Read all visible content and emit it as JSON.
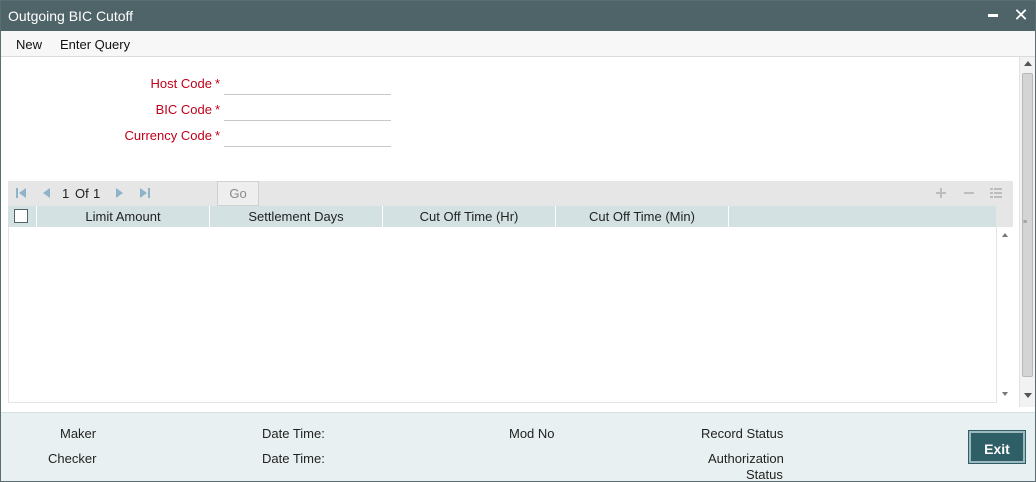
{
  "window": {
    "title": "Outgoing BIC Cutoff",
    "minimize_label": "−",
    "close_label": "✕"
  },
  "menu": {
    "new_label": "New",
    "enter_query_label": "Enter Query"
  },
  "form": {
    "host_code": {
      "label": "Host Code",
      "required_mark": "*",
      "value": ""
    },
    "bic_code": {
      "label": "BIC Code",
      "required_mark": "*",
      "value": ""
    },
    "currency_code": {
      "label": "Currency Code",
      "required_mark": "*",
      "value": ""
    }
  },
  "grid": {
    "pagination": {
      "current": "1",
      "of_label": "Of",
      "total": "1"
    },
    "go_label": "Go",
    "columns": [
      "Limit Amount",
      "Settlement Days",
      "Cut Off Time (Hr)",
      "Cut Off Time (Min)"
    ],
    "rows": []
  },
  "footer": {
    "maker_label": "Maker",
    "checker_label": "Checker",
    "date_time_label": "Date Time:",
    "mod_no_label": "Mod No",
    "record_status_label": "Record Status",
    "authorization_status_label_1": "Authorization",
    "authorization_status_label_2": "Status",
    "exit_label": "Exit"
  },
  "colors": {
    "titlebar": "#4f6468",
    "required_label": "#c0001b",
    "grid_header": "#d4e1e3",
    "footer_bg": "#e9f0f1",
    "exit_button": "#2f5f66"
  }
}
